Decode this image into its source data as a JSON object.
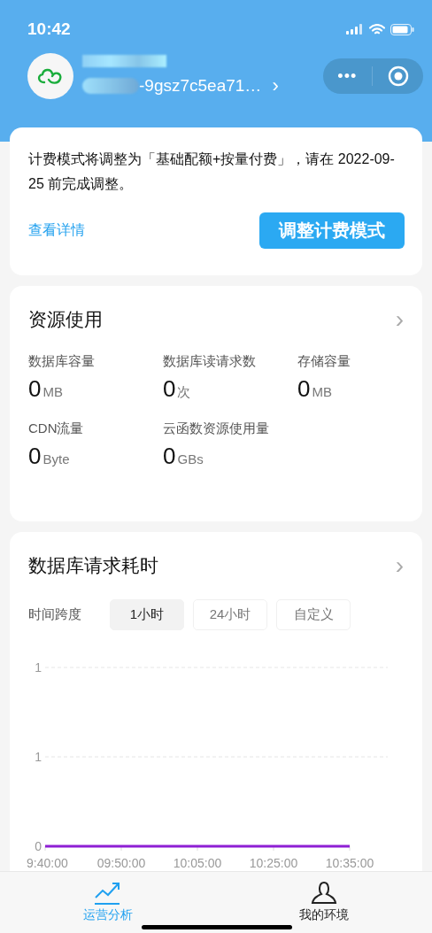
{
  "status_bar": {
    "time": "10:42"
  },
  "header": {
    "env_id": "-9gsz7c5ea71…",
    "chevron": "›",
    "menu_button": "•••"
  },
  "notice": {
    "text": "计费模式将调整为「基础配额+按量付费」，请在 2022-09-25 前完成调整。",
    "link": "查看详情",
    "button": "调整计费模式"
  },
  "resources": {
    "title": "资源使用",
    "chevron": "›",
    "metrics": [
      {
        "label": "数据库容量",
        "value": "0",
        "unit": "MB"
      },
      {
        "label": "数据库读请求数",
        "value": "0",
        "unit": "次"
      },
      {
        "label": "存储容量",
        "value": "0",
        "unit": "MB"
      },
      {
        "label": "CDN流量",
        "value": "0",
        "unit": "Byte"
      },
      {
        "label": "云函数资源使用量",
        "value": "0",
        "unit": "GBs"
      }
    ]
  },
  "db_latency": {
    "title": "数据库请求耗时",
    "chevron": "›",
    "span_label": "时间跨度",
    "spans": [
      {
        "label": "1小时",
        "selected": true
      },
      {
        "label": "24小时",
        "selected": false
      },
      {
        "label": "自定义",
        "selected": false
      }
    ],
    "chart_data": {
      "type": "line",
      "categories": [
        "9:40:00",
        "09:50:00",
        "10:05:00",
        "10:25:00",
        "10:35:00"
      ],
      "series": [
        {
          "color": "#8e1fd4",
          "values": [
            0,
            0,
            0,
            0,
            0
          ]
        }
      ],
      "ylim": [
        0,
        1
      ],
      "yticks": [
        {
          "value": 0,
          "label": "0"
        },
        {
          "value": 0.5,
          "label": "1"
        },
        {
          "value": 1,
          "label": "1"
        }
      ]
    }
  },
  "tab_bar": {
    "items": [
      {
        "label": "运营分析",
        "kind": "chart",
        "selected": true
      },
      {
        "label": "我的环境",
        "kind": "person",
        "selected": false
      }
    ]
  }
}
